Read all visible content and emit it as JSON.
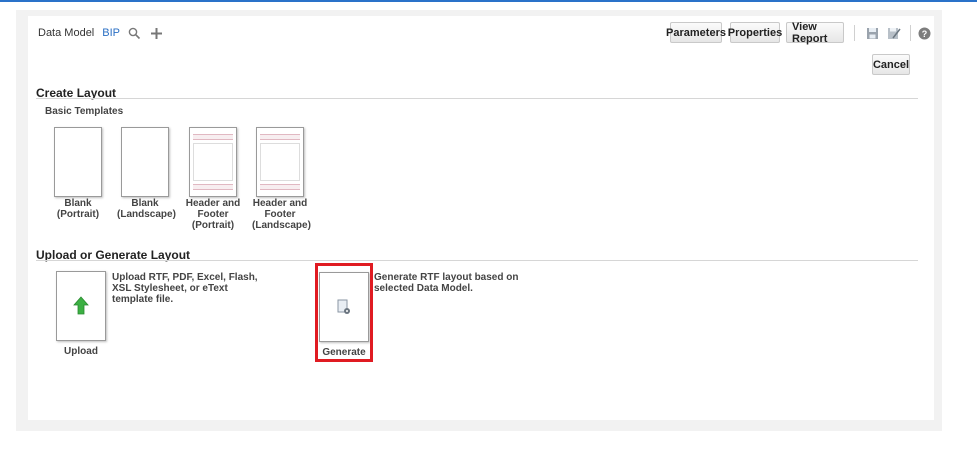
{
  "toolbar": {
    "data_model_label": "Data Model",
    "bip_label": "BIP",
    "search_icon": "search-icon",
    "add_icon": "plus-icon",
    "parameters_label": "Parameters",
    "properties_label": "Properties",
    "view_report_label": "View Report",
    "save_icon": "save-icon",
    "save_as_icon": "save-as-icon",
    "help_icon": "help-icon"
  },
  "cancel_label": "Cancel",
  "create_layout": {
    "title": "Create Layout",
    "subtitle": "Basic Templates",
    "templates": [
      {
        "label": "Blank\n(Portrait)"
      },
      {
        "label": "Blank\n(Landscape)"
      },
      {
        "label": "Header and\nFooter\n(Portrait)"
      },
      {
        "label": "Header and\nFooter\n(Landscape)"
      }
    ]
  },
  "upload_generate": {
    "title": "Upload or Generate Layout",
    "upload_label": "Upload",
    "upload_desc": "Upload RTF, PDF, Excel, Flash,\nXSL Stylesheet, or eText\ntemplate file.",
    "generate_label": "Generate",
    "generate_desc": "Generate RTF layout based on\nselected Data Model."
  },
  "colors": {
    "accent": "#2a72c9",
    "highlight": "#e01b22",
    "upload_arrow": "#3cb043"
  }
}
